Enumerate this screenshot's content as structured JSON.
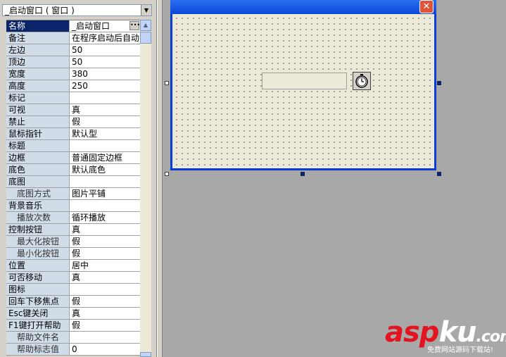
{
  "object_selector": {
    "value": "_启动窗口 ( 窗口 )"
  },
  "properties": [
    {
      "name": "名称",
      "value": "_启动窗口",
      "selected": true,
      "has_button": true
    },
    {
      "name": "备注",
      "value": "在程序启动后自动"
    },
    {
      "name": "左边",
      "value": "50"
    },
    {
      "name": "顶边",
      "value": "50"
    },
    {
      "name": "宽度",
      "value": "380"
    },
    {
      "name": "高度",
      "value": "250"
    },
    {
      "name": "标记",
      "value": ""
    },
    {
      "name": "可视",
      "value": "真"
    },
    {
      "name": "禁止",
      "value": "假"
    },
    {
      "name": "鼠标指针",
      "value": "默认型"
    },
    {
      "name": "标题",
      "value": ""
    },
    {
      "name": "边框",
      "value": "普通固定边框"
    },
    {
      "name": "底色",
      "value": "默认底色"
    },
    {
      "name": "底图",
      "value": ""
    },
    {
      "name": "底图方式",
      "value": "图片平铺",
      "sub": true
    },
    {
      "name": "背景音乐",
      "value": ""
    },
    {
      "name": "播放次数",
      "value": "循环播放",
      "sub": true
    },
    {
      "name": "控制按钮",
      "value": "真"
    },
    {
      "name": "最大化按钮",
      "value": "假",
      "sub": true
    },
    {
      "name": "最小化按钮",
      "value": "假",
      "sub": true
    },
    {
      "name": "位置",
      "value": "居中"
    },
    {
      "name": "可否移动",
      "value": "真"
    },
    {
      "name": "图标",
      "value": ""
    },
    {
      "name": "回车下移焦点",
      "value": "假"
    },
    {
      "name": "Esc键关闭",
      "value": "真"
    },
    {
      "name": "F1键打开帮助",
      "value": "假"
    },
    {
      "name": "帮助文件名",
      "value": "",
      "sub": true
    },
    {
      "name": "帮助标志值",
      "value": "0",
      "sub": true
    }
  ],
  "form": {
    "close_glyph": "✕",
    "title_color": "#0b47d8",
    "client_color": "#ece9d8"
  },
  "watermark": {
    "logo_part1": "asp",
    "logo_part2": "ku",
    "logo_part3": ".com",
    "tagline": "免费网站源码下载站!"
  }
}
